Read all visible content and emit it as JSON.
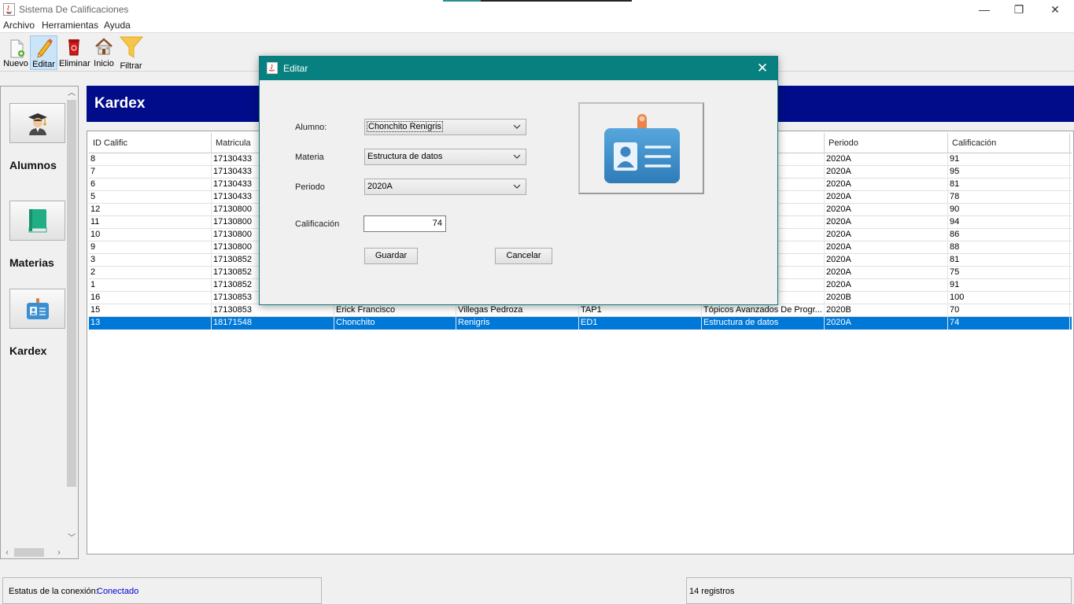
{
  "window": {
    "title": "Sistema De Calificaciones",
    "minimize_glyph": "—",
    "restore_glyph": "❐",
    "close_glyph": "✕"
  },
  "menu": [
    "Archivo",
    "Herramientas",
    "Ayuda"
  ],
  "toolbar": {
    "nuevo": "Nuevo",
    "editar": "Editar",
    "eliminar": "Eliminar",
    "inicio": "Inicio",
    "filtrar": "Filtrar"
  },
  "nav": {
    "alumnos": "Alumnos",
    "materias": "Materias",
    "kardex": "Kardex"
  },
  "main": {
    "header": "Kardex"
  },
  "table": {
    "columns": [
      "ID Calific",
      "Matricula",
      "",
      "",
      "",
      "",
      "Periodo",
      "Calificación"
    ],
    "rows": [
      [
        "8",
        "17130433",
        "",
        "",
        "",
        "",
        "2020A",
        "91"
      ],
      [
        "7",
        "17130433",
        "",
        "",
        "",
        "De Progr...",
        "2020A",
        "95"
      ],
      [
        "6",
        "17130433",
        "",
        "",
        "",
        "",
        "2020A",
        "81"
      ],
      [
        "5",
        "17130433",
        "",
        "",
        "",
        "datos",
        "2020A",
        "78"
      ],
      [
        "12",
        "17130800",
        "",
        "",
        "",
        "",
        "2020A",
        "90"
      ],
      [
        "11",
        "17130800",
        "",
        "",
        "",
        "De Progr...",
        "2020A",
        "94"
      ],
      [
        "10",
        "17130800",
        "",
        "",
        "",
        "",
        "2020A",
        "86"
      ],
      [
        "9",
        "17130800",
        "",
        "",
        "",
        "datos",
        "2020A",
        "88"
      ],
      [
        "3",
        "17130852",
        "",
        "",
        "",
        "De Progr...",
        "2020A",
        "81"
      ],
      [
        "2",
        "17130852",
        "",
        "",
        "",
        "",
        "2020A",
        "75"
      ],
      [
        "1",
        "17130852",
        "",
        "",
        "",
        "datos",
        "2020A",
        "91"
      ],
      [
        "16",
        "17130853",
        "",
        "",
        "",
        "",
        "2020B",
        "100"
      ],
      [
        "15",
        "17130853",
        "Erick Francisco",
        "Villegas Pedroza",
        "TAP1",
        "Tópicos Avanzados De Progr...",
        "2020B",
        "70"
      ],
      [
        "13",
        "18171548",
        "Chonchito",
        "Renigris",
        "ED1",
        "Estructura de datos",
        "2020A",
        "74"
      ]
    ],
    "selected_row": 13
  },
  "status": {
    "label": "Estatus de la conexión:",
    "value": "Conectado",
    "records": "14 registros"
  },
  "dialog": {
    "title": "Editar",
    "close_glyph": "✕",
    "alumno_label": "Alumno:",
    "alumno_value": "Chonchito Renigris",
    "materia_label": "Materia",
    "materia_value": "Estructura de datos",
    "periodo_label": "Periodo",
    "periodo_value": "2020A",
    "calificacion_label": "Calificación",
    "calificacion_value": "74",
    "guardar": "Guardar",
    "cancelar": "Cancelar"
  },
  "colors": {
    "header_blue": "#000c8a",
    "dialog_teal": "#088080",
    "selection_blue": "#0078d7",
    "status_link": "#0000cc"
  }
}
